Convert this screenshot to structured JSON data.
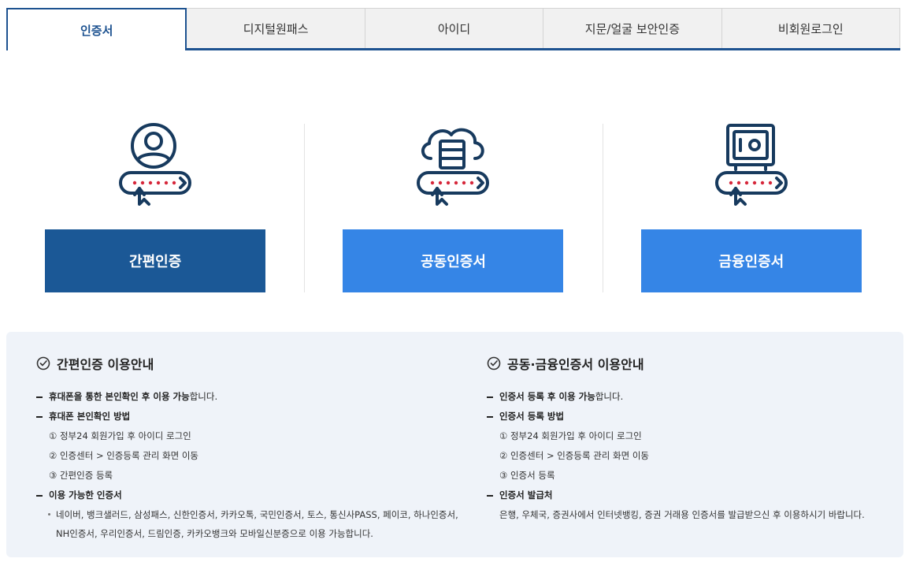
{
  "tabs": [
    {
      "label": "인증서",
      "active": true
    },
    {
      "label": "디지털원패스",
      "active": false
    },
    {
      "label": "아이디",
      "active": false
    },
    {
      "label": "지문/얼굴 보안인증",
      "active": false
    },
    {
      "label": "비회원로그인",
      "active": false
    }
  ],
  "options": [
    {
      "label": "간편인증",
      "icon": "user-badge-icon",
      "color": "#1b5896"
    },
    {
      "label": "공동인증서",
      "icon": "cloud-server-icon",
      "color": "#3585e6"
    },
    {
      "label": "금융인증서",
      "icon": "safe-icon",
      "color": "#3585e6"
    }
  ],
  "guide_simple": {
    "title": "간편인증 이용안내",
    "line1_bold": "휴대폰을 통한 본인확인 후 이용 가능",
    "line1_rest": "합니다.",
    "method_title": "휴대폰 본인확인 방법",
    "steps": [
      "① 정부24 회원가입 후 아이디 로그인",
      "② 인증센터 > 인증등록 관리 화면 이동",
      "③ 간편인증 등록"
    ],
    "available_title": "이용 가능한 인증서",
    "available_text": "네이버, 뱅크샐러드, 삼성패스, 신한인증서, 카카오톡, 국민인증서, 토스, 통신사PASS, 페이코, 하나인증서, NH인증서, 우리인증서, 드림인증, 카카오뱅크와 모바일신분증으로 이용 가능합니다."
  },
  "guide_cert": {
    "title": "공동·금융인증서 이용안내",
    "line1_bold": "인증서 등록 후 이용 가능",
    "line1_rest": "합니다.",
    "method_title": "인증서 등록 방법",
    "steps": [
      "① 정부24 회원가입 후 아이디 로그인",
      "② 인증센터 > 인증등록 관리 화면 이동",
      "③ 인증서 등록"
    ],
    "issuer_title": "인증서 발급처",
    "issuer_text": "은행, 우체국, 증권사에서 인터넷뱅킹, 증권 거래용 인증서를 발급받으신 후 이용하시기 바랍니다."
  },
  "colors": {
    "primary": "#1d5290",
    "button_dark": "#1b5896",
    "button_light": "#3585e6",
    "panel_bg": "#eff3f9",
    "icon_red": "#d6263a"
  }
}
